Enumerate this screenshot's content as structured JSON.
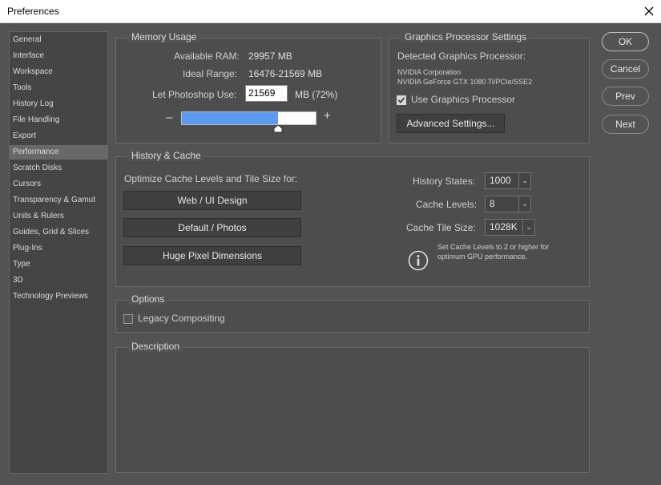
{
  "window": {
    "title": "Preferences"
  },
  "sidebar": {
    "items": [
      {
        "label": "General"
      },
      {
        "label": "Interface"
      },
      {
        "label": "Workspace"
      },
      {
        "label": "Tools"
      },
      {
        "label": "History Log"
      },
      {
        "label": "File Handling"
      },
      {
        "label": "Export"
      },
      {
        "label": "Performance"
      },
      {
        "label": "Scratch Disks"
      },
      {
        "label": "Cursors"
      },
      {
        "label": "Transparency & Gamut"
      },
      {
        "label": "Units & Rulers"
      },
      {
        "label": "Guides, Grid & Slices"
      },
      {
        "label": "Plug-Ins"
      },
      {
        "label": "Type"
      },
      {
        "label": "3D"
      },
      {
        "label": "Technology Previews"
      }
    ],
    "active_index": 7
  },
  "memory": {
    "title": "Memory Usage",
    "available_label": "Available RAM:",
    "available_value": "29957 MB",
    "ideal_label": "Ideal Range:",
    "ideal_value": "16476-21569 MB",
    "let_label": "Let Photoshop Use:",
    "let_value": "21569",
    "let_unit": "MB (72%)",
    "slider_fraction": 0.72,
    "minus": "–",
    "plus": "+"
  },
  "gpu": {
    "title": "Graphics Processor Settings",
    "detected_label": "Detected Graphics Processor:",
    "vendor": "NVIDIA Corporation",
    "model": "NVIDIA GeForce GTX 1080 Ti/PCIe/SSE2",
    "use_label": "Use Graphics Processor",
    "use_checked": true,
    "advanced_label": "Advanced Settings..."
  },
  "history_cache": {
    "title": "History & Cache",
    "optimize_label": "Optimize Cache Levels and Tile Size for:",
    "btn_web": "Web / UI Design",
    "btn_default": "Default / Photos",
    "btn_huge": "Huge Pixel Dimensions",
    "history_states_label": "History States:",
    "history_states_value": "1000",
    "cache_levels_label": "Cache Levels:",
    "cache_levels_value": "8",
    "tile_size_label": "Cache Tile Size:",
    "tile_size_value": "1028K",
    "info_line1": "Set Cache Levels to 2 or higher for",
    "info_line2": "optimum GPU performance."
  },
  "options": {
    "title": "Options",
    "legacy_label": "Legacy Compositing",
    "legacy_checked": false
  },
  "description": {
    "title": "Description"
  },
  "buttons": {
    "ok": "OK",
    "cancel": "Cancel",
    "prev": "Prev",
    "next": "Next"
  }
}
